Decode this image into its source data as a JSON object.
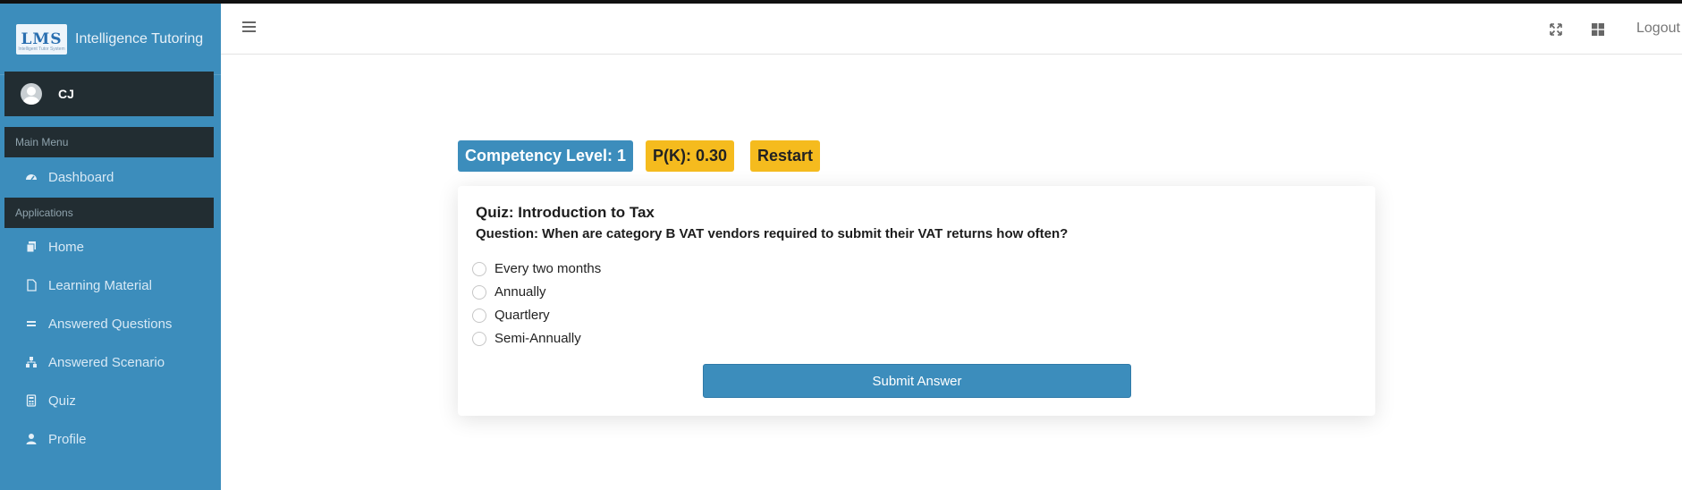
{
  "app": {
    "title": "Intelligence Tutoring",
    "logo_text": "LMS",
    "logo_subtext": "Intelligent Tutor System"
  },
  "user": {
    "name": "CJ"
  },
  "sidebar": {
    "main_menu_header": "Main Menu",
    "applications_header": "Applications",
    "items": [
      {
        "label": "Dashboard",
        "icon": "dashboard-icon"
      },
      {
        "label": "Home",
        "icon": "copy-icon"
      },
      {
        "label": "Learning Material",
        "icon": "file-icon"
      },
      {
        "label": "Answered Questions",
        "icon": "equals-icon"
      },
      {
        "label": "Answered Scenario",
        "icon": "sitemap-icon"
      },
      {
        "label": "Quiz",
        "icon": "calculator-icon"
      },
      {
        "label": "Profile",
        "icon": "user-icon"
      }
    ]
  },
  "header": {
    "logout_label": "Logout"
  },
  "badges": {
    "competency": "Competency Level: 1",
    "pk": "P(K): 0.30",
    "restart": "Restart"
  },
  "quiz": {
    "title": "Quiz: Introduction to Tax",
    "question": "Question: When are category B VAT vendors required to submit their VAT returns how often?",
    "options": [
      "Every two months",
      "Annually",
      "Quartlery",
      "Semi-Annually"
    ],
    "submit_label": "Submit Answer"
  },
  "colors": {
    "primary": "#3c8dbc",
    "dark": "#222d32",
    "warning": "#f5bb1e"
  }
}
